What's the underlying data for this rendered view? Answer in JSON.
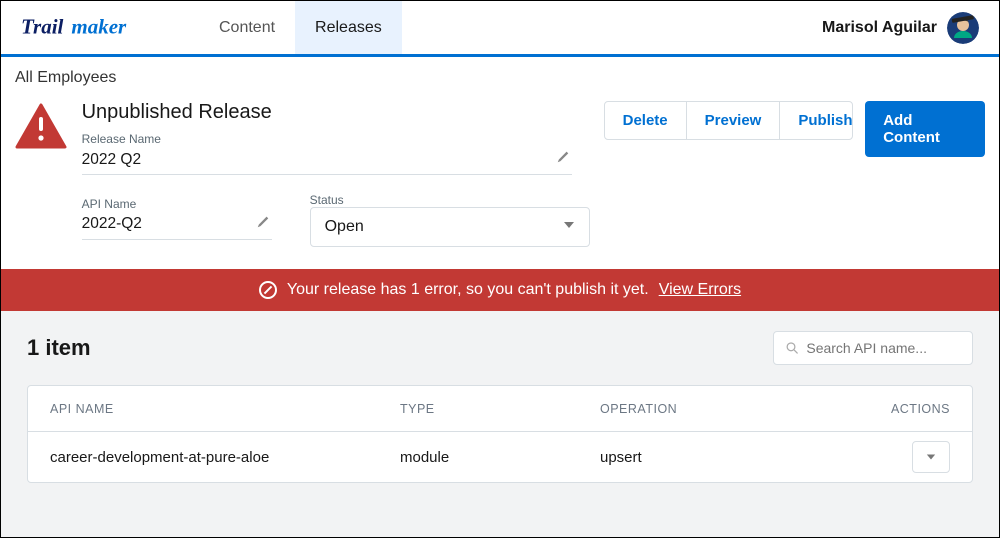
{
  "brand": {
    "word1": "Trail",
    "word2": "maker"
  },
  "nav": {
    "tabs": [
      "Content",
      "Releases"
    ],
    "active_index": 1
  },
  "user": {
    "name": "Marisol Aguilar"
  },
  "breadcrumb": "All Employees",
  "release": {
    "heading": "Unpublished Release",
    "name_label": "Release Name",
    "name_value": "2022 Q2",
    "api_label": "API Name",
    "api_value": "2022-Q2",
    "status_label": "Status",
    "status_value": "Open"
  },
  "buttons": {
    "delete": "Delete",
    "preview": "Preview",
    "publish": "Publish",
    "add_content": "Add Content"
  },
  "banner": {
    "message": "Your release has 1 error, so you can't publish it yet.",
    "link": "View Errors"
  },
  "items": {
    "count_label": "1 item",
    "search_placeholder": "Search API name...",
    "columns": {
      "api": "API NAME",
      "type": "TYPE",
      "op": "OPERATION",
      "actions": "ACTIONS"
    },
    "rows": [
      {
        "api": "career-development-at-pure-aloe",
        "type": "module",
        "op": "upsert"
      }
    ]
  }
}
